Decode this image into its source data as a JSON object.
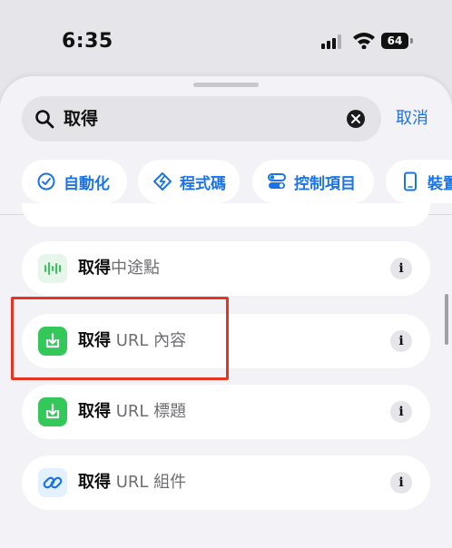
{
  "status": {
    "time": "6:35",
    "battery": "64"
  },
  "search": {
    "query": "取得",
    "cancel_label": "取消"
  },
  "categories": [
    {
      "label": "自動化",
      "icon": "clock-check-icon"
    },
    {
      "label": "程式碼",
      "icon": "code-diamond-icon"
    },
    {
      "label": "控制項目",
      "icon": "toggle-icon"
    },
    {
      "label": "裝置",
      "icon": "phone-icon"
    }
  ],
  "actions": [
    {
      "bold": "取得",
      "rest": "中途點",
      "icon": "waveform-icon",
      "icon_color": "#e6f6ea",
      "glyph_color": "#34c759"
    },
    {
      "bold": "取得",
      "rest": " URL 內容",
      "icon": "download-tray-icon",
      "icon_color": "#34c759",
      "glyph_color": "#ffffff"
    },
    {
      "bold": "取得",
      "rest": " URL 標題",
      "icon": "download-tray-icon",
      "icon_color": "#34c759",
      "glyph_color": "#ffffff"
    },
    {
      "bold": "取得",
      "rest": " URL 組件",
      "icon": "link-icon",
      "icon_color": "#e3f0fd",
      "glyph_color": "#1a73e8"
    }
  ],
  "info_label": "i",
  "accent": "#1a73e8",
  "highlight_color": "#e53422"
}
